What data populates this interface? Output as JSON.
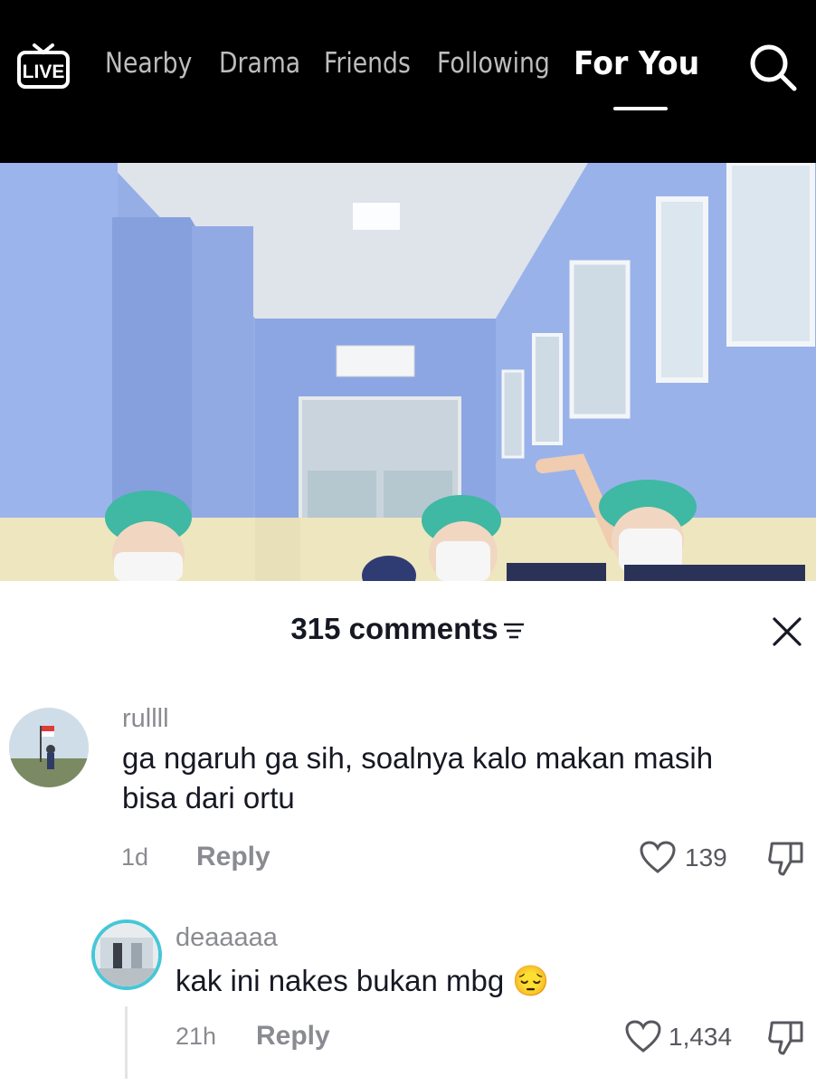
{
  "nav": {
    "live_label": "LIVE",
    "tabs": [
      {
        "label": "Nearby",
        "active": false
      },
      {
        "label": "Drama",
        "active": false
      },
      {
        "label": "Friends",
        "active": false
      },
      {
        "label": "Following",
        "active": false
      },
      {
        "label": "For You",
        "active": true
      }
    ],
    "search_icon": "search-icon"
  },
  "comments_sheet": {
    "title": "315 comments",
    "filter_icon": "sort-icon",
    "close_icon": "close-icon",
    "comments": [
      {
        "username": "rullll",
        "text": "ga ngaruh ga sih, soalnya kalo makan masih bisa dari ortu",
        "time": "1d",
        "reply_label": "Reply",
        "likes": "139"
      }
    ],
    "replies": [
      {
        "username": "deaaaaa",
        "text": "kak ini nakes bukan mbg",
        "emoji": "😔",
        "time": "21h",
        "reply_label": "Reply",
        "likes": "1,434"
      }
    ]
  },
  "colors": {
    "nav_bg": "#000000",
    "nav_active": "#ffffff",
    "nav_inactive": "#bdbdbd",
    "text_primary": "#161823",
    "text_secondary": "#8a8b91"
  }
}
